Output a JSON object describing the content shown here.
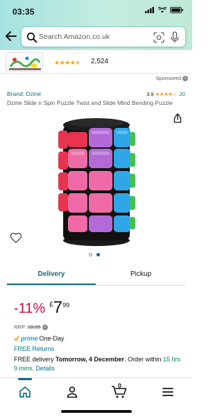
{
  "status_bar": {
    "time": "03:35"
  },
  "search": {
    "placeholder": "Search Amazon.co.uk"
  },
  "shop_banner": {
    "rating_count": "2,524"
  },
  "sponsored_label": "Sponsored",
  "product": {
    "brand": "Brand: Dzine",
    "rating_value": "3.9",
    "rating_count": "20",
    "title": "Dzine Slide n Spin Puzzle Twist and Slide Mind Bending Puzzle",
    "image_page": 2,
    "image_pages": 2
  },
  "tabs": {
    "delivery": "Delivery",
    "pickup": "Pickup"
  },
  "price": {
    "discount": "-11%",
    "currency": "£",
    "whole": "7",
    "fraction": "99",
    "rrp_label": "RRP:",
    "rrp_value": "£8.95"
  },
  "prime": {
    "word": "prime",
    "label": "One-Day"
  },
  "free_returns": "FREE Returns",
  "delivery": {
    "prefix": "FREE delivery ",
    "date": "Tomorrow, 4 December",
    "order_text": ". Order within ",
    "countdown": "15 hrs 9 mins",
    "separator": ". ",
    "details_link": "Details"
  },
  "bottom_nav": {
    "cart_count": "0"
  },
  "colors": {
    "accent": "#0f6b79",
    "price_red": "#cc0c39",
    "link": "#007185",
    "star": "#ff9900",
    "prime_blue": "#1a98ff"
  }
}
